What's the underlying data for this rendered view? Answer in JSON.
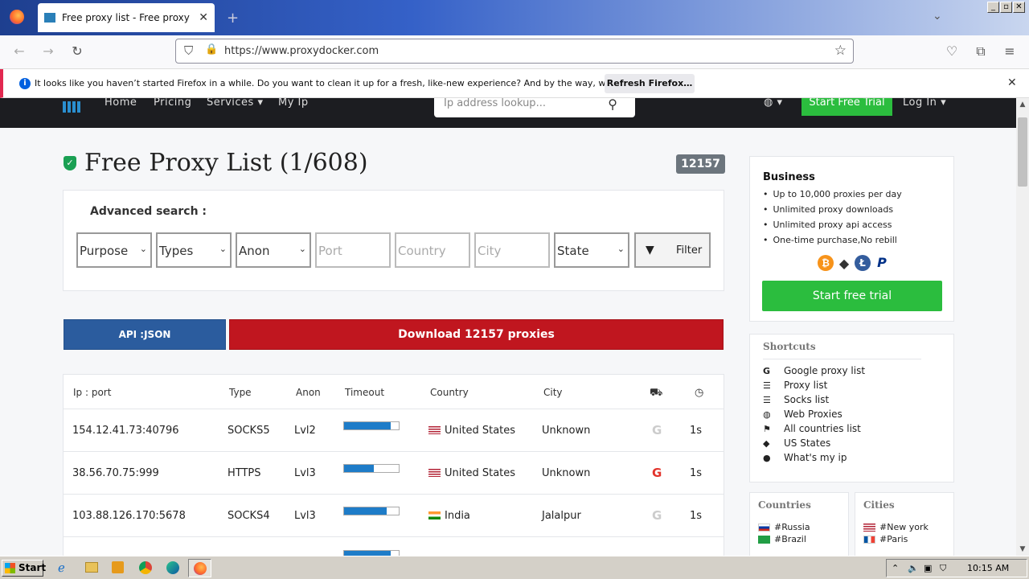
{
  "browser": {
    "tab_title": "Free proxy list - Free proxy server",
    "url": "https://www.proxydocker.com",
    "notification": "It looks like you haven’t started Firefox in a while. Do you want to clean it up for a fresh, like-new experience? And by the way, welcome back!",
    "refresh_label": "Refresh Firefox…"
  },
  "site": {
    "nav": [
      "Home",
      "Pricing",
      "Services",
      "My Ip"
    ],
    "search_placeholder": "Ip address lookup...",
    "trial_header": "Start Free Trial",
    "login": "Log In"
  },
  "page": {
    "title": "Free Proxy List (1/608)",
    "count_badge": "12157",
    "advanced_label": "Advanced search :",
    "filters": {
      "purpose": "Purpose",
      "types": "Types",
      "anon": "Anon",
      "port": "Port",
      "country": "Country",
      "city": "City",
      "state": "State",
      "filter_btn": "Filter"
    },
    "api_btn": "API :JSON",
    "download_btn": "Download 12157 proxies"
  },
  "table": {
    "headers": [
      "Ip : port",
      "Type",
      "Anon",
      "Timeout",
      "Country",
      "City"
    ],
    "rows": [
      {
        "ip": "154.12.41.73:40796",
        "type": "SOCKS5",
        "anon": "Lvl2",
        "timeout": 0.85,
        "country": "United States",
        "city": "Unknown",
        "google": "gray",
        "time": "1s"
      },
      {
        "ip": "38.56.70.75:999",
        "type": "HTTPS",
        "anon": "Lvl3",
        "timeout": 0.55,
        "country": "United States",
        "city": "Unknown",
        "google": "red",
        "time": "1s"
      },
      {
        "ip": "103.88.126.170:5678",
        "type": "SOCKS4",
        "anon": "Lvl3",
        "timeout": 0.78,
        "country": "India",
        "city": "Jalalpur",
        "google": "gray",
        "time": "1s"
      }
    ]
  },
  "business": {
    "title": "Business",
    "items": [
      "Up to 10,000 proxies per day",
      "Unlimited proxy downloads",
      "Unlimited proxy api access",
      "One-time purchase,No rebill"
    ],
    "trial_btn": "Start free trial"
  },
  "shortcuts": {
    "title": "Shortcuts",
    "items": [
      {
        "icon": "google-icon",
        "label": "Google proxy list"
      },
      {
        "icon": "list-icon",
        "label": "Proxy list"
      },
      {
        "icon": "list-icon",
        "label": "Socks list"
      },
      {
        "icon": "globe-icon",
        "label": "Web Proxies"
      },
      {
        "icon": "flag-icon",
        "label": "All countries list"
      },
      {
        "icon": "tag-icon",
        "label": "US States"
      },
      {
        "icon": "pin-icon",
        "label": "What's my ip"
      }
    ]
  },
  "countries": {
    "title": "Countries",
    "items": [
      "#Russia",
      "#Brazil"
    ]
  },
  "cities": {
    "title": "Cities",
    "items": [
      "#New york",
      "#Paris"
    ]
  },
  "taskbar": {
    "start": "Start",
    "clock": "10:15 AM"
  },
  "colors": {
    "green": "#2bbd3e",
    "api_blue": "#2b5c9e",
    "download_red": "#c0161f",
    "bar_blue": "#1e7cc8"
  }
}
